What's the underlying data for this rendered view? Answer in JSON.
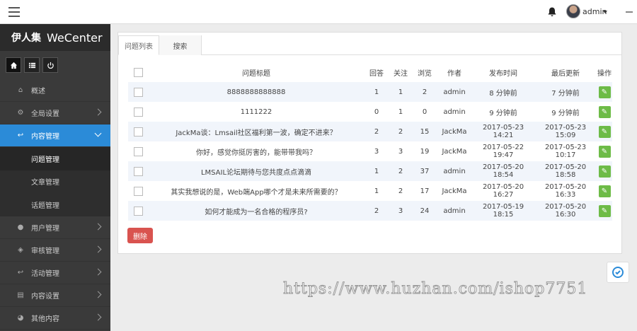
{
  "topbar": {
    "user": "admin"
  },
  "brand": {
    "cn": "伊人集",
    "en": "WeCenter"
  },
  "sidebar": {
    "items": [
      {
        "label": "概述",
        "icon": "home-icon",
        "active": false
      },
      {
        "label": "全局设置",
        "icon": "gear-icon",
        "active": false
      },
      {
        "label": "内容管理",
        "icon": "reply-icon",
        "active": true
      },
      {
        "label": "用户管理",
        "icon": "user-icon",
        "active": false
      },
      {
        "label": "审核管理",
        "icon": "shield-icon",
        "active": false
      },
      {
        "label": "活动管理",
        "icon": "reply-icon",
        "active": false
      },
      {
        "label": "内容设置",
        "icon": "list-icon",
        "active": false
      },
      {
        "label": "其他内容",
        "icon": "pie-icon",
        "active": false
      }
    ],
    "sub_items": [
      "问题管理",
      "文章管理",
      "话题管理"
    ]
  },
  "tabs": [
    "问题列表",
    "搜索"
  ],
  "table": {
    "headers": [
      "问题标题",
      "回答",
      "关注",
      "浏览",
      "作者",
      "发布时间",
      "最后更新",
      "操作"
    ],
    "rows": [
      {
        "title": "8888888888888",
        "answers": "1",
        "follows": "1",
        "views": "2",
        "author": "admin",
        "published": "8 分钟前",
        "updated": "7 分钟前"
      },
      {
        "title": "1111222",
        "answers": "0",
        "follows": "1",
        "views": "0",
        "author": "admin",
        "published": "9 分钟前",
        "updated": "9 分钟前"
      },
      {
        "title": "JackMa谈：Lmsail社区福利第一波，确定不进来？",
        "answers": "2",
        "follows": "2",
        "views": "15",
        "author": "JackMa",
        "published": "2017-05-23 14:21",
        "updated": "2017-05-23 15:09"
      },
      {
        "title": "你好，感觉你挺厉害的，能带带我吗？",
        "answers": "3",
        "follows": "3",
        "views": "19",
        "author": "JackMa",
        "published": "2017-05-22 19:47",
        "updated": "2017-05-23 10:17"
      },
      {
        "title": "LMSAIL论坛期待与您共度点点滴滴",
        "answers": "1",
        "follows": "2",
        "views": "37",
        "author": "admin",
        "published": "2017-05-20 18:54",
        "updated": "2017-05-20 18:58"
      },
      {
        "title": "其实我想说的是，Web端App哪个才是未来所需要的？",
        "answers": "1",
        "follows": "2",
        "views": "17",
        "author": "JackMa",
        "published": "2017-05-20 16:27",
        "updated": "2017-05-20 16:33"
      },
      {
        "title": "如何才能成为一名合格的程序员?",
        "answers": "2",
        "follows": "3",
        "views": "24",
        "author": "admin",
        "published": "2017-05-19 18:15",
        "updated": "2017-05-20 16:30"
      }
    ]
  },
  "actions": {
    "delete": "删除"
  },
  "watermark": "https://www.huzhan.com/ishop7751",
  "colors": {
    "accent": "#2b8bd8",
    "edit": "#6dbb47",
    "danger": "#d9534f",
    "sidebar": "#3a3a3a"
  }
}
